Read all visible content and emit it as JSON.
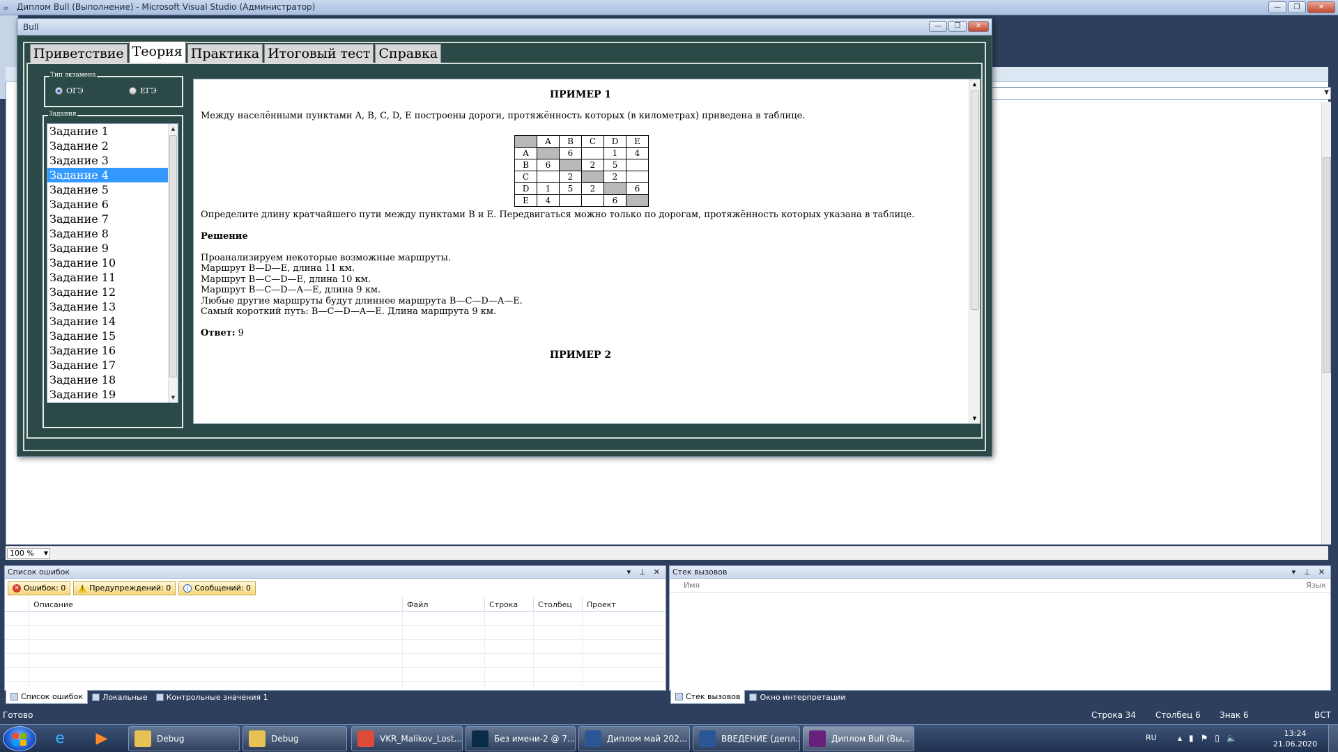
{
  "vs": {
    "title": "Диплом Bull (Выполнение) - Microsoft Visual Studio (Администратор)",
    "zoom": "100 %",
    "status": {
      "ready": "Готово",
      "line": "Строка 34",
      "column": "Столбец 6",
      "char": "Знак 6",
      "mode": "ВСТ"
    },
    "errors_pane": {
      "title": "Список ошибок",
      "filters": [
        "Ошибок: 0",
        "Предупреждений: 0",
        "Сообщений: 0"
      ],
      "columns": [
        "Описание",
        "Файл",
        "Строка",
        "Столбец",
        "Проект"
      ]
    },
    "callstack_pane": {
      "title": "Стек вызовов",
      "columns": [
        "Имя",
        "Язык"
      ]
    },
    "bottom_tabs_left": [
      "Список ошибок",
      "Локальные",
      "Контрольные значения 1"
    ],
    "bottom_tabs_right": [
      "Стек вызовов",
      "Окно интерпретации"
    ]
  },
  "bull": {
    "title": "Bull",
    "tabs": [
      "Приветствие",
      "Теория",
      "Практика",
      "Итоговый тест",
      "Справка"
    ],
    "active_tab": 1,
    "exam_type": {
      "legend": "Тип экзамена",
      "options": [
        "ОГЭ",
        "ЕГЭ"
      ],
      "selected": 0
    },
    "tasks": {
      "legend": "Задания",
      "items": [
        "Задание 1",
        "Задание 2",
        "Задание 3",
        "Задание 4",
        "Задание 5",
        "Задание 6",
        "Задание 7",
        "Задание 8",
        "Задание 9",
        "Задание 10",
        "Задание 11",
        "Задание 12",
        "Задание 13",
        "Задание 14",
        "Задание 15",
        "Задание 16",
        "Задание 17",
        "Задание 18",
        "Задание 19"
      ],
      "selected": 3
    },
    "theory": {
      "example1_title": "ПРИМЕР 1",
      "intro": "Между населёнными пунктами A, B, C, D, E построены дороги, протяжённость которых (в километрах) приведена в таблице.",
      "table": {
        "headers": [
          "",
          "A",
          "B",
          "C",
          "D",
          "E"
        ],
        "rows": [
          [
            "A",
            "",
            "6",
            "",
            "1",
            "4"
          ],
          [
            "B",
            "6",
            "",
            "2",
            "5",
            ""
          ],
          [
            "C",
            "",
            "2",
            "",
            "2",
            ""
          ],
          [
            "D",
            "1",
            "5",
            "2",
            "",
            "6"
          ],
          [
            "E",
            "4",
            "",
            "",
            "6",
            ""
          ]
        ]
      },
      "question": "Определите длину кратчайшего пути между пунктами B и E. Передвигаться можно только по дорогам, протяжённость которых указана в таблице.",
      "solution_label": "Решение",
      "solution_lines": [
        "Проанализируем некоторые возможные маршруты.",
        "Маршрут B—D—E, длина 11 км.",
        "Маршрут B—C—D—E, длина 10 км.",
        "Маршрут B—C—D—A—E, длина 9 км.",
        "Любые другие маршруты будут длиннее маршрута B—C—D—A—E.",
        "Самый короткий путь: B—C—D—A—E. Длина маршрута 9 км."
      ],
      "answer_label": "Ответ:",
      "answer_value": " 9",
      "example2_title": "ПРИМЕР 2"
    }
  },
  "taskbar": {
    "items": [
      {
        "label": "Debug",
        "icon": "folder-icon",
        "color": "#e7c153"
      },
      {
        "label": "Debug",
        "icon": "folder-icon",
        "color": "#e7c153"
      },
      {
        "label": "VKR_Malikov_Lost...",
        "icon": "chrome-icon",
        "color": "#dd4b39"
      },
      {
        "label": "Без имени-2 @ 7...",
        "icon": "photoshop-icon",
        "color": "#0a2a4a"
      },
      {
        "label": "Диплом май 202...",
        "icon": "word-icon",
        "color": "#2b5797"
      },
      {
        "label": "ВВЕДЕНИЕ (депл...",
        "icon": "word-icon",
        "color": "#2b5797"
      },
      {
        "label": "Диплом Bull (Вы...",
        "icon": "visual-studio-icon",
        "color": "#68217a"
      }
    ],
    "lang": "RU",
    "time": "13:24",
    "date": "21.06.2020"
  }
}
